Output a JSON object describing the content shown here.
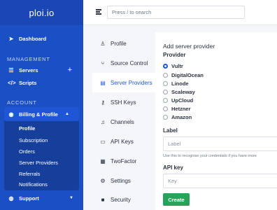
{
  "app": {
    "brand": "ploi.io"
  },
  "topbar": {
    "search_placeholder": "Press / to search"
  },
  "sidebar": {
    "dashboard": "Dashboard",
    "management_header": "MANAGEMENT",
    "servers": "Servers",
    "scripts": "Scripts",
    "account_header": "ACCOUNT",
    "billing": "Billing & Profile",
    "billing_sub": [
      "Profile",
      "Subscription",
      "Orders",
      "Server Providers",
      "Referrals",
      "Notifications"
    ],
    "support": "Support"
  },
  "settings_nav": [
    {
      "label": "Profile",
      "icon": "user-icon"
    },
    {
      "label": "Source Control",
      "icon": "branch-icon"
    },
    {
      "label": "Server Providers",
      "icon": "server-icon"
    },
    {
      "label": "SSH Keys",
      "icon": "key-icon"
    },
    {
      "label": "Channels",
      "icon": "bell-icon"
    },
    {
      "label": "API Keys",
      "icon": "monitor-icon"
    },
    {
      "label": "TwoFactor",
      "icon": "grid-icon"
    },
    {
      "label": "Settings",
      "icon": "gear-icon"
    },
    {
      "label": "Security",
      "icon": "lock-icon"
    }
  ],
  "form": {
    "title": "Add server provider",
    "provider_label": "Provider",
    "providers": [
      "Vultr",
      "DigitalOcean",
      "Linode",
      "Scaleway",
      "UpCloud",
      "Hetzner",
      "Amazon"
    ],
    "selected_provider": "Vultr",
    "label_label": "Label",
    "label_placeholder": "Label",
    "label_help": "Use this to recognise your credentials if you have more",
    "api_key_label": "API key",
    "api_key_placeholder": "Key",
    "submit": "Create"
  },
  "colors": {
    "sidebar": "#1b4fc4",
    "accent": "#1f56d6",
    "create_button": "#27a35a"
  }
}
